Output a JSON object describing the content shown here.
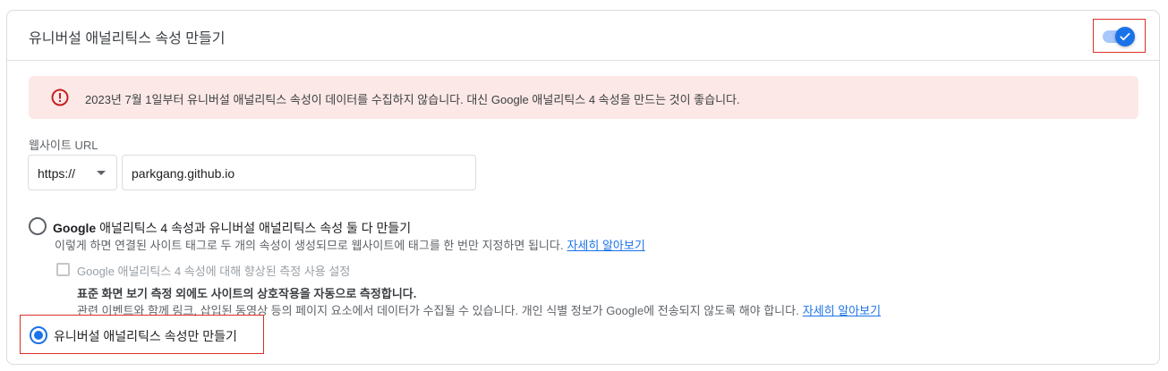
{
  "card": {
    "title": "유니버설 애널리틱스 속성 만들기",
    "toggle_on": true
  },
  "alert": {
    "text": "2023년 7월 1일부터 유니버설 애널리틱스 속성이 데이터를 수집하지 않습니다. 대신 Google 애널리틱스 4 속성을 만드는 것이 좋습니다."
  },
  "website": {
    "label": "웹사이트 URL",
    "protocol": "https://",
    "url": "parkgang.github.io"
  },
  "option_both": {
    "label_prefix": "Google",
    "label_rest": " 애널리틱스 4 속성과 유니버설 애널리틱스 속성 둘 다 만들기",
    "description": "이렇게 하면 연결된 사이트 태그로 두 개의 속성이 생성되므로 웹사이트에 태그를 한 번만 지정하면 됩니다.",
    "link": "자세히 알아보기",
    "checked": false
  },
  "enhanced_measurement": {
    "label": "Google 애널리틱스 4 속성에 대해 향상된 측정 사용 설정",
    "bold_text": "표준 화면 보기 측정 외에도 사이트의 상호작용을 자동으로 측정합니다.",
    "description": "관련 이벤트와 함께 링크, 삽입된 동영상 등의 페이지 요소에서 데이터가 수집될 수 있습니다. 개인 식별 정보가 Google에 전송되지 않도록 해야 합니다.",
    "link": "자세히 알아보기",
    "checked": false
  },
  "option_ua_only": {
    "label": "유니버설 애널리틱스 속성만 만들기",
    "checked": true
  }
}
